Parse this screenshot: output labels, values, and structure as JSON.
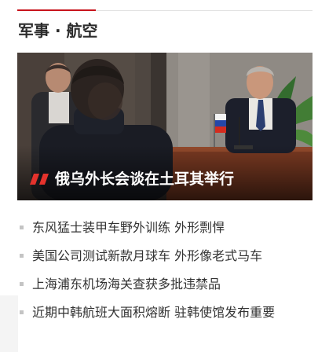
{
  "section": {
    "title": "军事 · 航空"
  },
  "feature": {
    "caption": "俄乌外长会谈在土耳其举行",
    "image_description_icon": "photo"
  },
  "news": [
    {
      "title": "东风猛士装甲车野外训练 外形剽悍"
    },
    {
      "title": "美国公司测试新款月球车 外形像老式马车"
    },
    {
      "title": "上海浦东机场海关查获多批违禁品"
    },
    {
      "title": "近期中韩航班大面积熔断 驻韩使馆发布重要"
    }
  ],
  "colors": {
    "accent": "#c8141c",
    "title": "#2c2c2c",
    "text": "#333333",
    "bullet": "#c4c4c4"
  }
}
